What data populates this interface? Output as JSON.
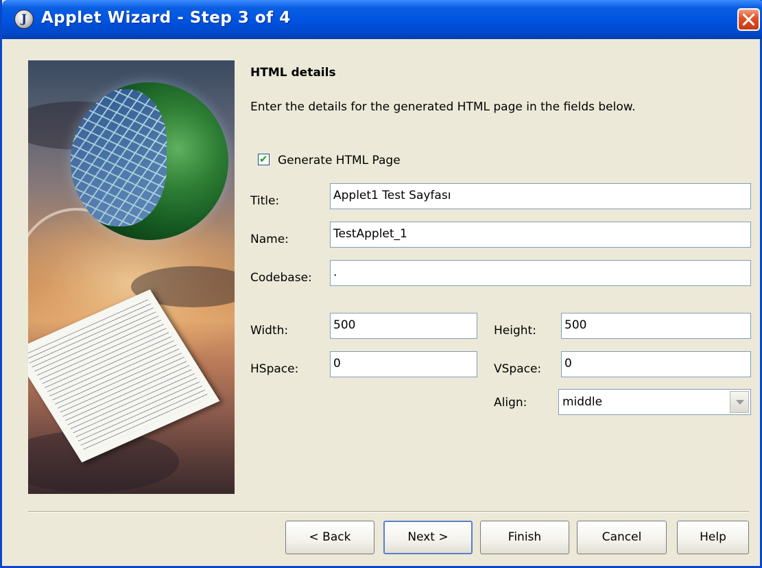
{
  "window": {
    "title": "Applet Wizard - Step 3 of 4",
    "icon": "java-app-icon",
    "titlebar_color": "#0054E3",
    "close_button_color": "#E0542A"
  },
  "art": {
    "description_icon": "globe-and-document-illustration"
  },
  "header": {
    "heading": "HTML details",
    "description": "Enter the details for the generated HTML page in the fields below."
  },
  "options": {
    "generate_html_label": "Generate HTML Page",
    "generate_html_checked": true
  },
  "fields": {
    "title_label": "Title:",
    "title_value": "Applet1 Test Sayfası",
    "name_label": "Name:",
    "name_value": "TestApplet_1",
    "codebase_label": "Codebase:",
    "codebase_value": ".",
    "width_label": "Width:",
    "width_value": "500",
    "height_label": "Height:",
    "height_value": "500",
    "hspace_label": "HSpace:",
    "hspace_value": "0",
    "vspace_label": "VSpace:",
    "vspace_value": "0",
    "align_label": "Align:",
    "align_value": "middle"
  },
  "buttons": {
    "back": "< Back",
    "next": "Next >",
    "finish": "Finish",
    "cancel": "Cancel",
    "help": "Help"
  }
}
